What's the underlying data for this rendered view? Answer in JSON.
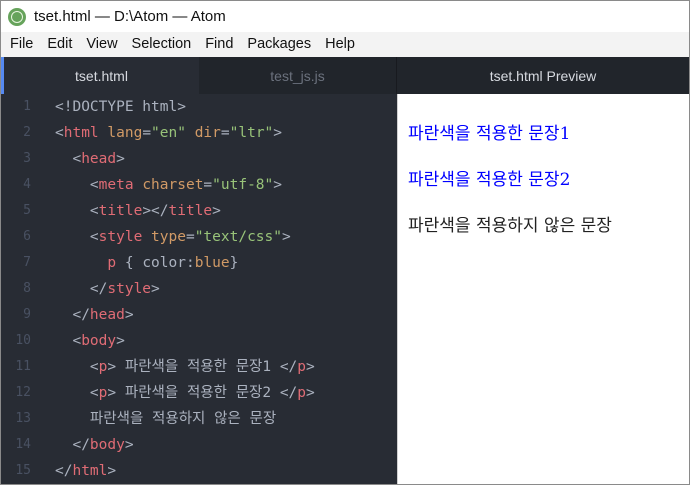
{
  "window": {
    "title": "tset.html — D:\\Atom — Atom"
  },
  "menu": [
    "File",
    "Edit",
    "View",
    "Selection",
    "Find",
    "Packages",
    "Help"
  ],
  "tabs": {
    "active": "tset.html",
    "inactive": "test_js.js",
    "preview": "tset.html Preview"
  },
  "editor": {
    "lines": [
      {
        "n": "1",
        "tokens": [
          [
            "p",
            "<!DOCTYPE html>"
          ]
        ]
      },
      {
        "n": "2",
        "tokens": [
          [
            "p",
            "<"
          ],
          [
            "t",
            "html"
          ],
          [
            "p",
            " "
          ],
          [
            "a",
            "lang"
          ],
          [
            "p",
            "="
          ],
          [
            "s",
            "\"en\""
          ],
          [
            "p",
            " "
          ],
          [
            "a",
            "dir"
          ],
          [
            "p",
            "="
          ],
          [
            "s",
            "\"ltr\""
          ],
          [
            "p",
            ">"
          ]
        ]
      },
      {
        "n": "3",
        "tokens": [
          [
            "p",
            "  <"
          ],
          [
            "t",
            "head"
          ],
          [
            "p",
            ">"
          ]
        ]
      },
      {
        "n": "4",
        "tokens": [
          [
            "p",
            "    <"
          ],
          [
            "t",
            "meta"
          ],
          [
            "p",
            " "
          ],
          [
            "a",
            "charset"
          ],
          [
            "p",
            "="
          ],
          [
            "s",
            "\"utf-8\""
          ],
          [
            "p",
            ">"
          ]
        ]
      },
      {
        "n": "5",
        "tokens": [
          [
            "p",
            "    <"
          ],
          [
            "t",
            "title"
          ],
          [
            "p",
            "></"
          ],
          [
            "t",
            "title"
          ],
          [
            "p",
            ">"
          ]
        ]
      },
      {
        "n": "6",
        "tokens": [
          [
            "p",
            "    <"
          ],
          [
            "t",
            "style"
          ],
          [
            "p",
            " "
          ],
          [
            "a",
            "type"
          ],
          [
            "p",
            "="
          ],
          [
            "s",
            "\"text/css\""
          ],
          [
            "p",
            ">"
          ]
        ]
      },
      {
        "n": "7",
        "tokens": [
          [
            "p",
            "      "
          ],
          [
            "t",
            "p"
          ],
          [
            "p",
            " { color:"
          ],
          [
            "v",
            "blue"
          ],
          [
            "p",
            "}"
          ]
        ]
      },
      {
        "n": "8",
        "tokens": [
          [
            "p",
            "    </"
          ],
          [
            "t",
            "style"
          ],
          [
            "p",
            ">"
          ]
        ]
      },
      {
        "n": "9",
        "tokens": [
          [
            "p",
            "  </"
          ],
          [
            "t",
            "head"
          ],
          [
            "p",
            ">"
          ]
        ]
      },
      {
        "n": "10",
        "tokens": [
          [
            "p",
            "  <"
          ],
          [
            "t",
            "body"
          ],
          [
            "p",
            ">"
          ]
        ]
      },
      {
        "n": "11",
        "tokens": [
          [
            "p",
            "    <"
          ],
          [
            "t",
            "p"
          ],
          [
            "p",
            "> 파란색을 적용한 문장1 </"
          ],
          [
            "t",
            "p"
          ],
          [
            "p",
            ">"
          ]
        ]
      },
      {
        "n": "12",
        "tokens": [
          [
            "p",
            "    <"
          ],
          [
            "t",
            "p"
          ],
          [
            "p",
            "> 파란색을 적용한 문장2 </"
          ],
          [
            "t",
            "p"
          ],
          [
            "p",
            ">"
          ]
        ]
      },
      {
        "n": "13",
        "tokens": [
          [
            "p",
            "    파란색을 적용하지 않은 문장"
          ]
        ]
      },
      {
        "n": "14",
        "tokens": [
          [
            "p",
            "  </"
          ],
          [
            "t",
            "body"
          ],
          [
            "p",
            ">"
          ]
        ]
      },
      {
        "n": "15",
        "tokens": [
          [
            "p",
            "</"
          ],
          [
            "t",
            "html"
          ],
          [
            "p",
            ">"
          ]
        ]
      }
    ]
  },
  "preview": {
    "p1": "파란색을 적용한 문장1",
    "p2": "파란색을 적용한 문장2",
    "p3": "파란색을 적용하지 않은 문장"
  },
  "colors": {
    "blue_text": "#0000ff",
    "editor_bg": "#282c34",
    "tag": "#e06c75",
    "attr": "#d19a66",
    "string": "#98c379",
    "accent": "#568af2"
  }
}
